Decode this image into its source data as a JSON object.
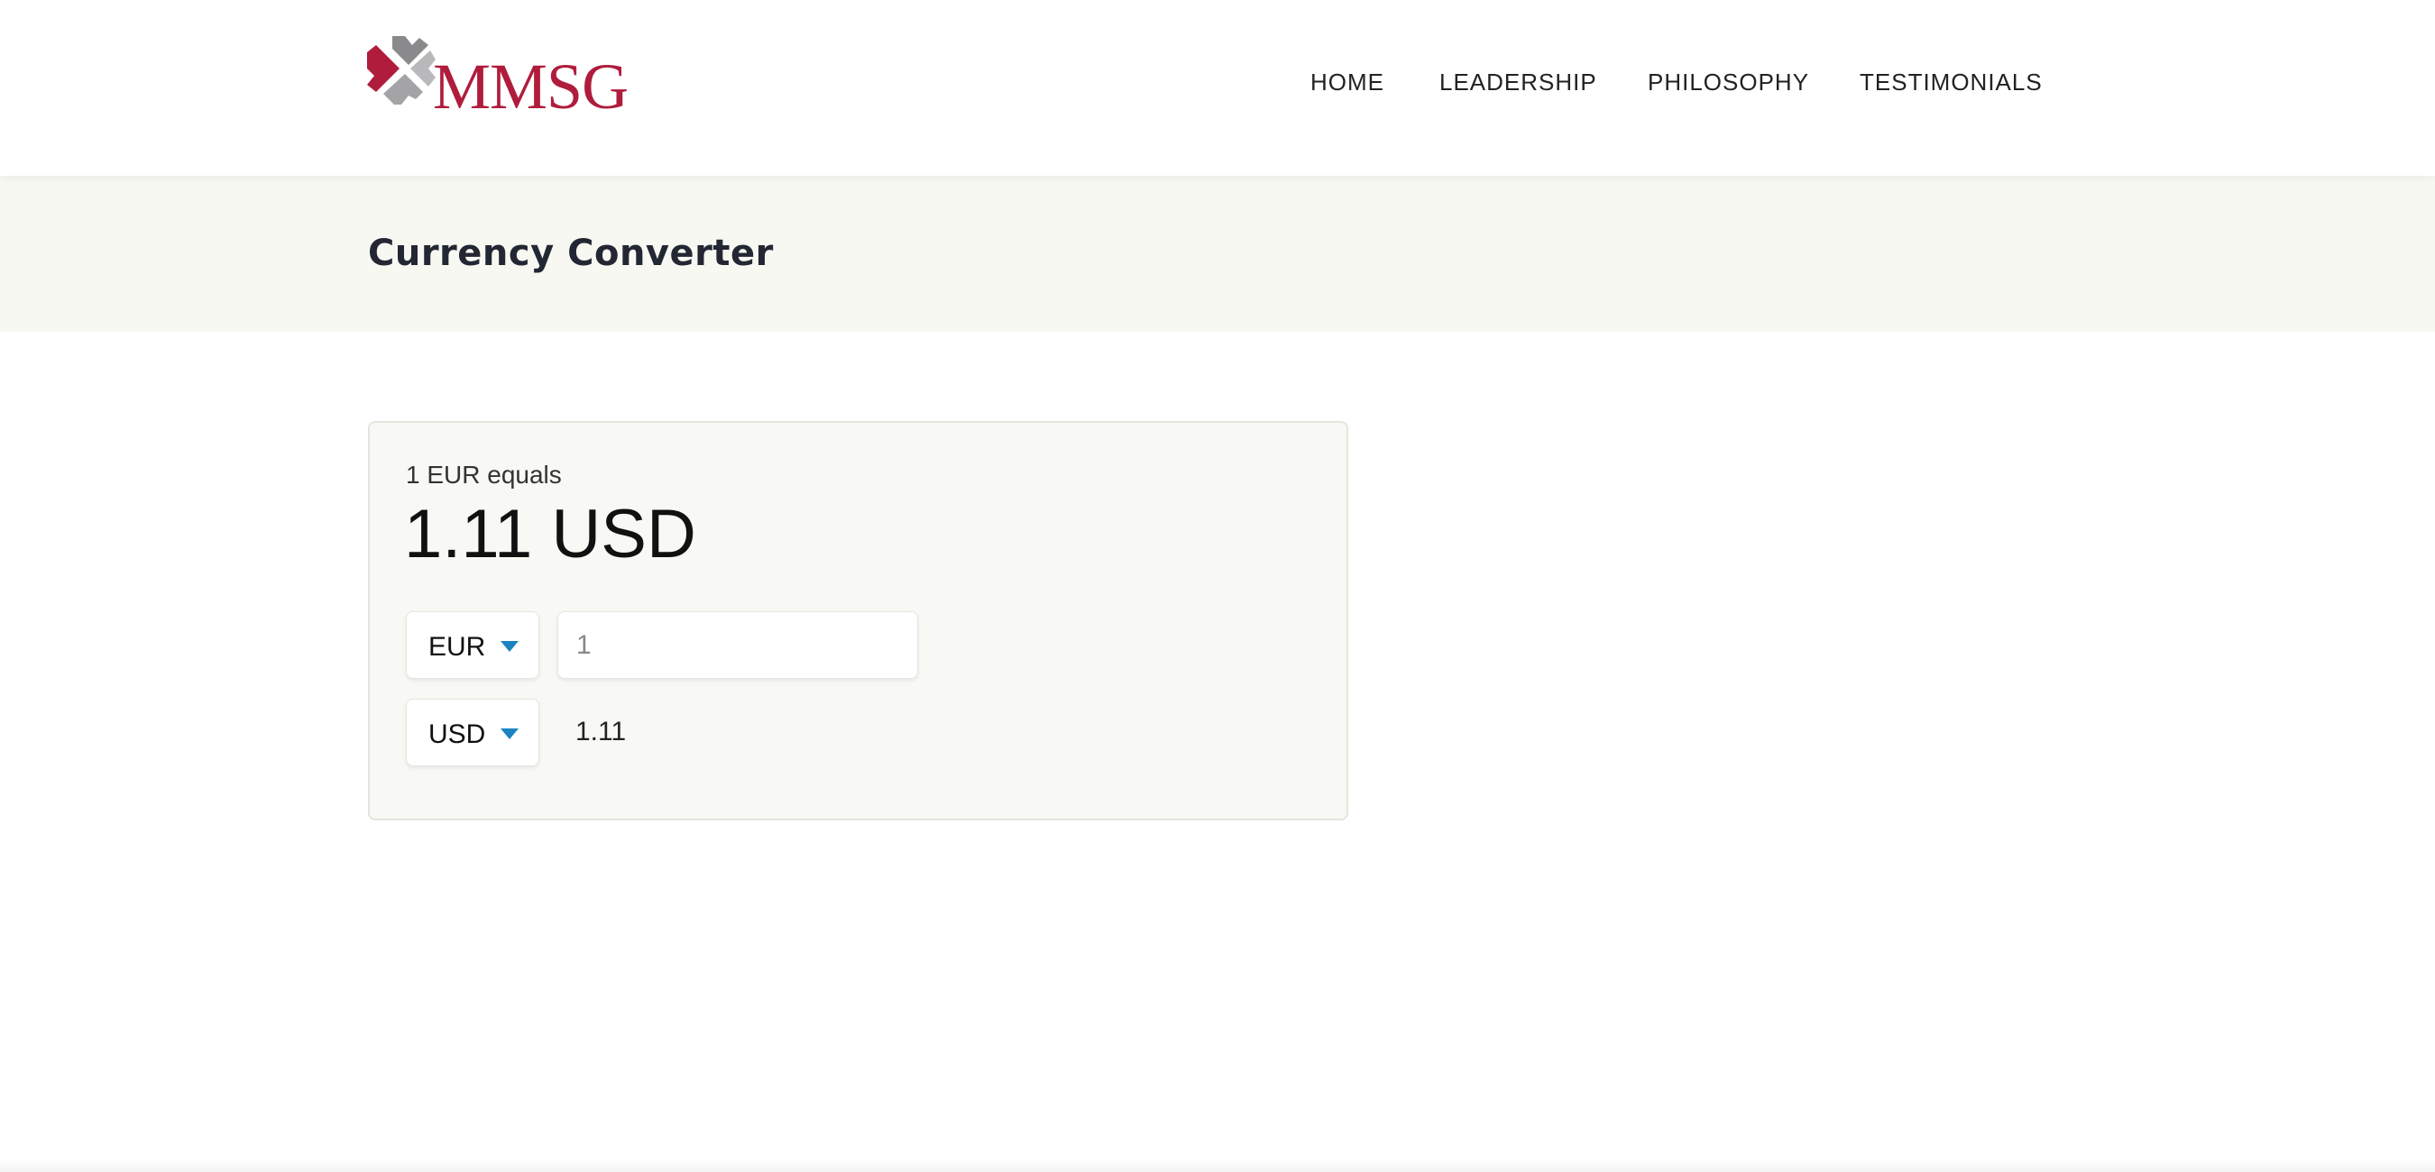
{
  "header": {
    "logo_text": "MMSG",
    "nav": [
      "HOME",
      "LEADERSHIP",
      "PHILOSOPHY",
      "TESTIMONIALS"
    ]
  },
  "page_title": "Currency Converter",
  "converter": {
    "summary_label": "1 EUR equals",
    "summary_value": "1.11 USD",
    "from_currency": "EUR",
    "amount_value": "1",
    "to_currency": "USD",
    "result_value": "1.11",
    "accent_color": "#1a84c0"
  }
}
